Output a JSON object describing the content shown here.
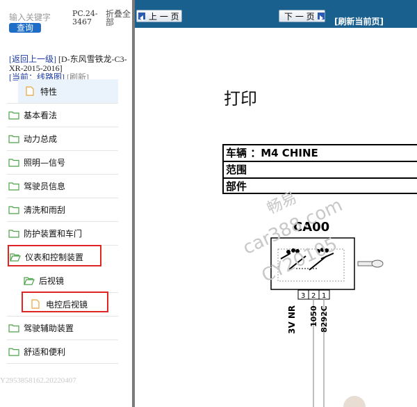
{
  "search": {
    "placeholder": "输入关键字",
    "button": "查询"
  },
  "header": {
    "code": "PC.24-3467",
    "collapse_label": "折叠全部"
  },
  "breadcrumb": {
    "back": "[返回上一级]",
    "vehicle": "[D-东风雪铁龙-C3-XR-2015-2016]",
    "current": "[当前：线路图]",
    "refresh": "[刷新]"
  },
  "tree": [
    {
      "label": "特性",
      "type": "file"
    },
    {
      "label": "基本看法",
      "type": "folder"
    },
    {
      "label": "动力总成",
      "type": "folder"
    },
    {
      "label": "照明—信号",
      "type": "folder"
    },
    {
      "label": "驾驶员信息",
      "type": "folder"
    },
    {
      "label": "清洗和雨刮",
      "type": "folder"
    },
    {
      "label": "防护装置和车门",
      "type": "folder"
    },
    {
      "label": "仪表和控制装置",
      "type": "folder-open"
    },
    {
      "label": "后视镜",
      "type": "folder-open"
    },
    {
      "label": "电控后视镜",
      "type": "file"
    },
    {
      "label": "驾驶辅助装置",
      "type": "folder"
    },
    {
      "label": "舒适和便利",
      "type": "folder"
    }
  ],
  "left_watermark": "Y2953858162.20220407",
  "toolbar": {
    "prev": "上 一 页",
    "next": "下 一 页",
    "refresh": "[刷新当前页]"
  },
  "doc": {
    "title": "打印",
    "rows": [
      "车辆 ：M4 CHINE",
      "范围",
      "部件"
    ],
    "component": "CA00",
    "pins": [
      "3",
      "2",
      "1"
    ],
    "wires": [
      "3V NR",
      "1050",
      "8292C"
    ],
    "watermarks": [
      "畅易",
      "car388.com",
      "CY20105"
    ]
  },
  "colors": {
    "toolbar": "#19608e",
    "search_button": "#1e6ec8",
    "highlight": "#e02424",
    "link": "#1b3aa6"
  }
}
